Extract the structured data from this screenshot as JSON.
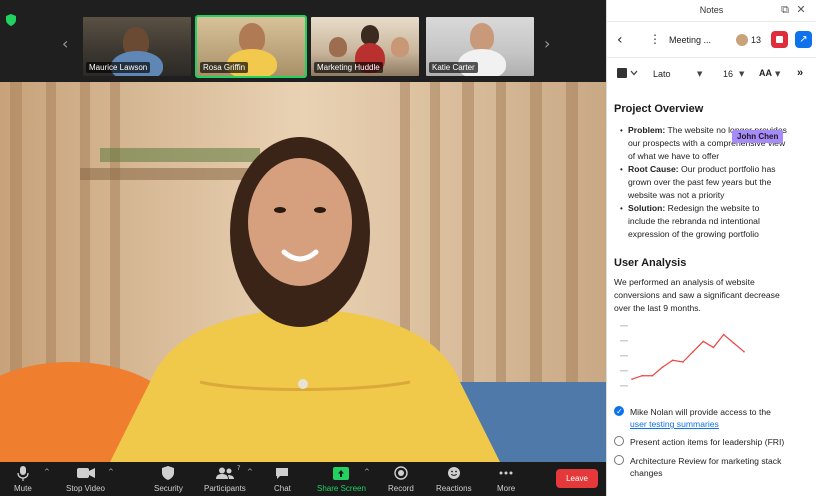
{
  "thumbnails": [
    {
      "name": "Maurice Lawson",
      "active": false
    },
    {
      "name": "Rosa Griffin",
      "active": true
    },
    {
      "name": "Marketing Huddle",
      "active": false
    },
    {
      "name": "Katie Carter",
      "active": false
    }
  ],
  "controls": {
    "mute": "Mute",
    "stop_video": "Stop Video",
    "security": "Security",
    "participants": "Participants",
    "participants_count": "7",
    "chat": "Chat",
    "share_screen": "Share Screen",
    "record": "Record",
    "reactions": "Reactions",
    "more": "More",
    "leave": "Leave"
  },
  "notes": {
    "panel_title": "Notes",
    "doc_title": "Meeting ...",
    "collaborator_count": "13",
    "font_name": "Lato",
    "font_size": "16",
    "text_color": "#333333",
    "project_overview": {
      "heading": "Project Overview",
      "bullets": [
        {
          "label": "Problem:",
          "lines": [
            "The website no longer provides",
            "our prospects with a comprehensive view",
            "of what we have to offer"
          ]
        },
        {
          "label": "Root Cause:",
          "lines": [
            "Our product portfolio has",
            "grown over the past few years but the",
            "website was not a priority"
          ]
        },
        {
          "label": "Solution:",
          "lines": [
            "Redesign the website to",
            "include the rebranda nd intentional",
            "expression of the growing portfolio"
          ]
        }
      ]
    },
    "collaborator_cursor": "John Chen",
    "user_analysis": {
      "heading": "User Analysis",
      "lines": [
        "We performed an analysis of website",
        "conversions and saw a significant decrease",
        "over the last 9 months."
      ]
    },
    "tasks": [
      {
        "checked": true,
        "text": "Mike Nolan will provide access to the",
        "link": "user testing summaries"
      },
      {
        "checked": false,
        "text": "Present action items for leadership (FRI)"
      },
      {
        "checked": false,
        "text": "Architecture Review for marketing stack",
        "text2": "changes"
      }
    ]
  },
  "chart_data": {
    "type": "line",
    "x": [
      1,
      2,
      3,
      4,
      5,
      6,
      7,
      8,
      9,
      10,
      11,
      12
    ],
    "values": [
      8,
      12,
      12,
      22,
      30,
      28,
      40,
      52,
      45,
      60,
      50,
      40
    ],
    "ylim": [
      0,
      70
    ],
    "color": "#ef4444",
    "ytick_count": 5
  }
}
